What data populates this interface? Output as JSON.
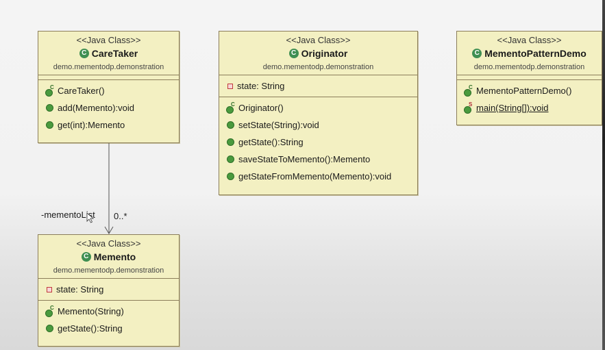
{
  "diagram": {
    "classes": {
      "caretaker": {
        "stereotype": "<<Java Class>>",
        "name": "CareTaker",
        "package": "demo.mementodp.demonstration",
        "attributes": [],
        "methods": [
          {
            "text": "CareTaker()",
            "icon": "constructor"
          },
          {
            "text": "add(Memento):void",
            "icon": "public-method"
          },
          {
            "text": "get(int):Memento",
            "icon": "public-method"
          }
        ]
      },
      "originator": {
        "stereotype": "<<Java Class>>",
        "name": "Originator",
        "package": "demo.mementodp.demonstration",
        "attributes": [
          {
            "text": "state: String",
            "icon": "private-field"
          }
        ],
        "methods": [
          {
            "text": "Originator()",
            "icon": "constructor"
          },
          {
            "text": "setState(String):void",
            "icon": "public-method"
          },
          {
            "text": "getState():String",
            "icon": "public-method"
          },
          {
            "text": "saveStateToMemento():Memento",
            "icon": "public-method"
          },
          {
            "text": "getStateFromMemento(Memento):void",
            "icon": "public-method"
          }
        ]
      },
      "mementopatterndemo": {
        "stereotype": "<<Java Class>>",
        "name": "MementoPatternDemo",
        "package": "demo.mementodp.demonstration",
        "attributes": [],
        "methods": [
          {
            "text": "MementoPatternDemo()",
            "icon": "constructor"
          },
          {
            "text": "main(String[]):void",
            "icon": "static-method"
          }
        ]
      },
      "memento": {
        "stereotype": "<<Java Class>>",
        "name": "Memento",
        "package": "demo.mementodp.demonstration",
        "attributes": [
          {
            "text": "state: String",
            "icon": "private-field"
          }
        ],
        "methods": [
          {
            "text": "Memento(String)",
            "icon": "constructor"
          },
          {
            "text": "getState():String",
            "icon": "public-method"
          }
        ]
      }
    },
    "association": {
      "from": "CareTaker",
      "to": "Memento",
      "role": "-mementoList",
      "multiplicity": "0..*"
    },
    "icons": {
      "class": "class-icon",
      "constructor": "constructor-icon",
      "public_method": "public-method-icon",
      "static_method": "static-method-icon",
      "private_field": "private-field-icon"
    },
    "colors": {
      "box_fill": "#f3f0c2",
      "box_border": "#8b7d5a",
      "class_icon": "#3f8f52",
      "method_icon": "#4a9a3e",
      "private_icon": "#c0393b"
    }
  }
}
